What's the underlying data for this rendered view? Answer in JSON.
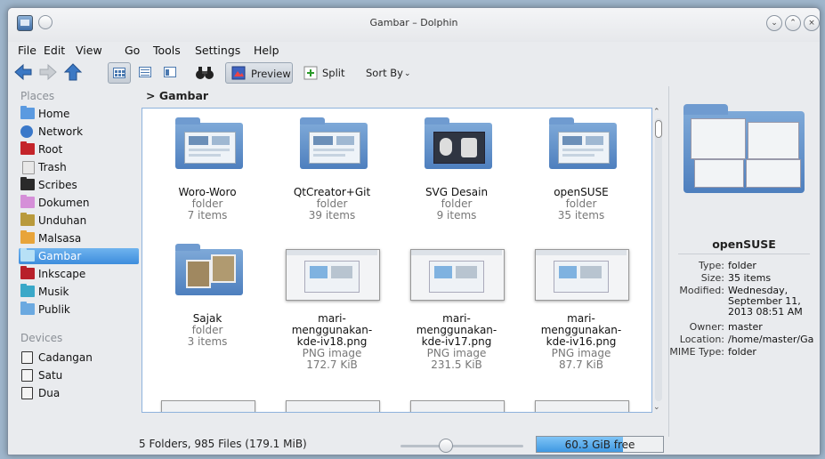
{
  "window": {
    "title": "Gambar – Dolphin"
  },
  "menu": [
    "File",
    "Edit",
    "View",
    "Go",
    "Tools",
    "Settings",
    "Help"
  ],
  "toolbar": {
    "preview_label": "Preview",
    "split_label": "Split",
    "sort_label": "Sort By"
  },
  "places": {
    "title": "Places",
    "items": [
      {
        "label": "Home",
        "icon": "home-folder-icon",
        "color": "#5b9ae0"
      },
      {
        "label": "Network",
        "icon": "globe-icon",
        "color": "#3a78c9"
      },
      {
        "label": "Root",
        "icon": "folder-red-icon",
        "color": "#c4242a"
      },
      {
        "label": "Trash",
        "icon": "trash-icon",
        "color": "#e8e8e8"
      },
      {
        "label": "Scribes",
        "icon": "folder-black-icon",
        "color": "#2a2a2a"
      },
      {
        "label": "Dokumen",
        "icon": "folder-pink-icon",
        "color": "#d58fd8"
      },
      {
        "label": "Unduhan",
        "icon": "folder-olive-icon",
        "color": "#b99a3c"
      },
      {
        "label": "Malsasa",
        "icon": "folder-orange-icon",
        "color": "#e8a43a"
      },
      {
        "label": "Gambar",
        "icon": "folder-light-icon",
        "color": "#b7e0f6"
      },
      {
        "label": "Inkscape",
        "icon": "folder-red-icon",
        "color": "#b8202a"
      },
      {
        "label": "Musik",
        "icon": "folder-teal-icon",
        "color": "#3aa8c8"
      },
      {
        "label": "Publik",
        "icon": "folder-blue-icon",
        "color": "#6ba9e0"
      }
    ],
    "selected_index": 8
  },
  "devices": {
    "title": "Devices",
    "items": [
      {
        "label": "Cadangan",
        "icon": "drive-icon"
      },
      {
        "label": "Satu",
        "icon": "drive-icon"
      },
      {
        "label": "Dua",
        "icon": "drive-icon"
      }
    ]
  },
  "breadcrumb": {
    "path": "Gambar"
  },
  "files": [
    {
      "name": "Woro-Woro",
      "type": "folder",
      "detail": "7 items",
      "kind": "folder"
    },
    {
      "name": "QtCreator+Git",
      "type": "folder",
      "detail": "39 items",
      "kind": "folder"
    },
    {
      "name": "SVG Desain",
      "type": "folder",
      "detail": "9 items",
      "kind": "folder-dark"
    },
    {
      "name": "openSUSE",
      "type": "folder",
      "detail": "35 items",
      "kind": "folder"
    },
    {
      "name": "Sajak",
      "type": "folder",
      "detail": "3 items",
      "kind": "folder-photo"
    },
    {
      "name": "mari-\nmenggunakan-\nkde-iv18.png",
      "type": "PNG image",
      "detail": "172.7 KiB",
      "kind": "image"
    },
    {
      "name": "mari-\nmenggunakan-\nkde-iv17.png",
      "type": "PNG image",
      "detail": "231.5 KiB",
      "kind": "image"
    },
    {
      "name": "mari-\nmenggunakan-\nkde-iv16.png",
      "type": "PNG image",
      "detail": "87.7 KiB",
      "kind": "image"
    }
  ],
  "info_panel": {
    "title": "openSUSE",
    "rows": [
      {
        "k": "Type:",
        "v": "folder"
      },
      {
        "k": "Size:",
        "v": "35 items"
      },
      {
        "k": "Modified:",
        "v": "Wednesday, September 11, 2013 08:51 AM"
      },
      {
        "k": "Owner:",
        "v": "master"
      },
      {
        "k": "Location:",
        "v": "/home/master/Ga"
      },
      {
        "k": "MIME Type:",
        "v": "folder"
      }
    ]
  },
  "status": {
    "summary": "5 Folders, 985 Files (179.1 MiB)",
    "free_space": "60.3 GiB free",
    "used_fraction": 0.68
  }
}
